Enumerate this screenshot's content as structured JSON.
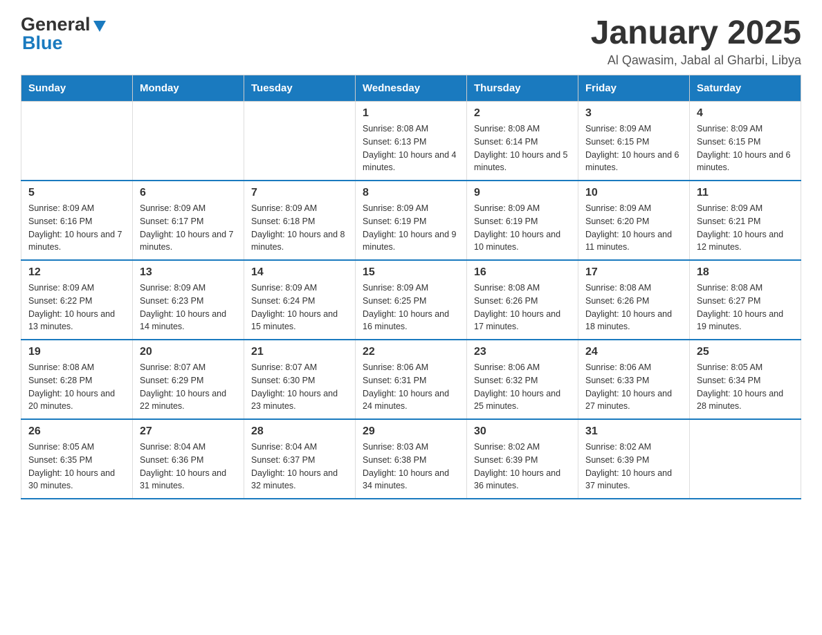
{
  "header": {
    "logo": {
      "general": "General",
      "blue": "Blue"
    },
    "title": "January 2025",
    "subtitle": "Al Qawasim, Jabal al Gharbi, Libya"
  },
  "calendar": {
    "headers": [
      "Sunday",
      "Monday",
      "Tuesday",
      "Wednesday",
      "Thursday",
      "Friday",
      "Saturday"
    ],
    "rows": [
      [
        {
          "day": "",
          "info": ""
        },
        {
          "day": "",
          "info": ""
        },
        {
          "day": "",
          "info": ""
        },
        {
          "day": "1",
          "info": "Sunrise: 8:08 AM\nSunset: 6:13 PM\nDaylight: 10 hours and 4 minutes."
        },
        {
          "day": "2",
          "info": "Sunrise: 8:08 AM\nSunset: 6:14 PM\nDaylight: 10 hours and 5 minutes."
        },
        {
          "day": "3",
          "info": "Sunrise: 8:09 AM\nSunset: 6:15 PM\nDaylight: 10 hours and 6 minutes."
        },
        {
          "day": "4",
          "info": "Sunrise: 8:09 AM\nSunset: 6:15 PM\nDaylight: 10 hours and 6 minutes."
        }
      ],
      [
        {
          "day": "5",
          "info": "Sunrise: 8:09 AM\nSunset: 6:16 PM\nDaylight: 10 hours and 7 minutes."
        },
        {
          "day": "6",
          "info": "Sunrise: 8:09 AM\nSunset: 6:17 PM\nDaylight: 10 hours and 7 minutes."
        },
        {
          "day": "7",
          "info": "Sunrise: 8:09 AM\nSunset: 6:18 PM\nDaylight: 10 hours and 8 minutes."
        },
        {
          "day": "8",
          "info": "Sunrise: 8:09 AM\nSunset: 6:19 PM\nDaylight: 10 hours and 9 minutes."
        },
        {
          "day": "9",
          "info": "Sunrise: 8:09 AM\nSunset: 6:19 PM\nDaylight: 10 hours and 10 minutes."
        },
        {
          "day": "10",
          "info": "Sunrise: 8:09 AM\nSunset: 6:20 PM\nDaylight: 10 hours and 11 minutes."
        },
        {
          "day": "11",
          "info": "Sunrise: 8:09 AM\nSunset: 6:21 PM\nDaylight: 10 hours and 12 minutes."
        }
      ],
      [
        {
          "day": "12",
          "info": "Sunrise: 8:09 AM\nSunset: 6:22 PM\nDaylight: 10 hours and 13 minutes."
        },
        {
          "day": "13",
          "info": "Sunrise: 8:09 AM\nSunset: 6:23 PM\nDaylight: 10 hours and 14 minutes."
        },
        {
          "day": "14",
          "info": "Sunrise: 8:09 AM\nSunset: 6:24 PM\nDaylight: 10 hours and 15 minutes."
        },
        {
          "day": "15",
          "info": "Sunrise: 8:09 AM\nSunset: 6:25 PM\nDaylight: 10 hours and 16 minutes."
        },
        {
          "day": "16",
          "info": "Sunrise: 8:08 AM\nSunset: 6:26 PM\nDaylight: 10 hours and 17 minutes."
        },
        {
          "day": "17",
          "info": "Sunrise: 8:08 AM\nSunset: 6:26 PM\nDaylight: 10 hours and 18 minutes."
        },
        {
          "day": "18",
          "info": "Sunrise: 8:08 AM\nSunset: 6:27 PM\nDaylight: 10 hours and 19 minutes."
        }
      ],
      [
        {
          "day": "19",
          "info": "Sunrise: 8:08 AM\nSunset: 6:28 PM\nDaylight: 10 hours and 20 minutes."
        },
        {
          "day": "20",
          "info": "Sunrise: 8:07 AM\nSunset: 6:29 PM\nDaylight: 10 hours and 22 minutes."
        },
        {
          "day": "21",
          "info": "Sunrise: 8:07 AM\nSunset: 6:30 PM\nDaylight: 10 hours and 23 minutes."
        },
        {
          "day": "22",
          "info": "Sunrise: 8:06 AM\nSunset: 6:31 PM\nDaylight: 10 hours and 24 minutes."
        },
        {
          "day": "23",
          "info": "Sunrise: 8:06 AM\nSunset: 6:32 PM\nDaylight: 10 hours and 25 minutes."
        },
        {
          "day": "24",
          "info": "Sunrise: 8:06 AM\nSunset: 6:33 PM\nDaylight: 10 hours and 27 minutes."
        },
        {
          "day": "25",
          "info": "Sunrise: 8:05 AM\nSunset: 6:34 PM\nDaylight: 10 hours and 28 minutes."
        }
      ],
      [
        {
          "day": "26",
          "info": "Sunrise: 8:05 AM\nSunset: 6:35 PM\nDaylight: 10 hours and 30 minutes."
        },
        {
          "day": "27",
          "info": "Sunrise: 8:04 AM\nSunset: 6:36 PM\nDaylight: 10 hours and 31 minutes."
        },
        {
          "day": "28",
          "info": "Sunrise: 8:04 AM\nSunset: 6:37 PM\nDaylight: 10 hours and 32 minutes."
        },
        {
          "day": "29",
          "info": "Sunrise: 8:03 AM\nSunset: 6:38 PM\nDaylight: 10 hours and 34 minutes."
        },
        {
          "day": "30",
          "info": "Sunrise: 8:02 AM\nSunset: 6:39 PM\nDaylight: 10 hours and 36 minutes."
        },
        {
          "day": "31",
          "info": "Sunrise: 8:02 AM\nSunset: 6:39 PM\nDaylight: 10 hours and 37 minutes."
        },
        {
          "day": "",
          "info": ""
        }
      ]
    ]
  }
}
